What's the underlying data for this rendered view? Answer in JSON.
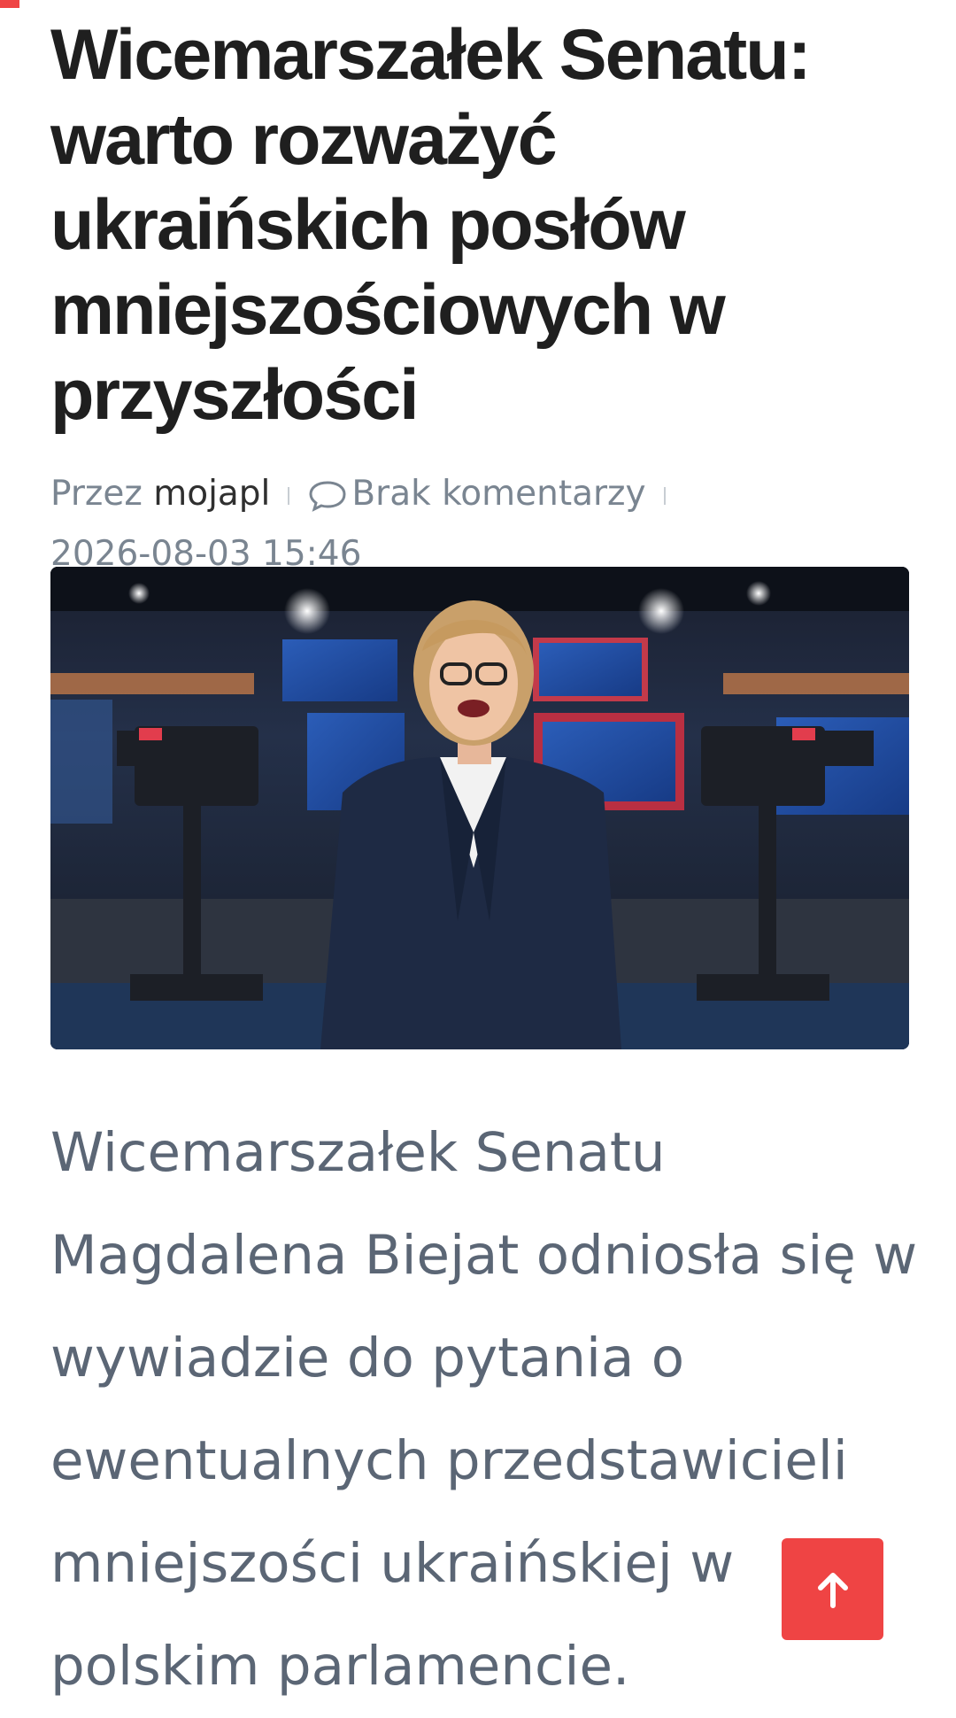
{
  "article": {
    "title": "Wicemarszałek Senatu: warto rozważyć ukraińskich posłów mniejszościowych w przyszłości",
    "meta": {
      "by_label": "Przez",
      "author": "mojapl",
      "comments": "Brak komentarzy",
      "date": "2026-08-03 15:46"
    },
    "hero_image": {
      "icon": "news-studio-photo"
    },
    "lead": "Wicemarszałek Senatu Magdalena Biejat odniosła się w wywiadzie do pytania o ewentualnych przedstawicieli mniejszości ukraińskiej w polskim parlamencie."
  },
  "ui": {
    "scroll_top_icon": "arrow-up-icon",
    "accent_color": "#ef4444",
    "title_color": "#1f1f1f",
    "meta_color": "#7a8591",
    "lead_color": "#5b6675"
  }
}
